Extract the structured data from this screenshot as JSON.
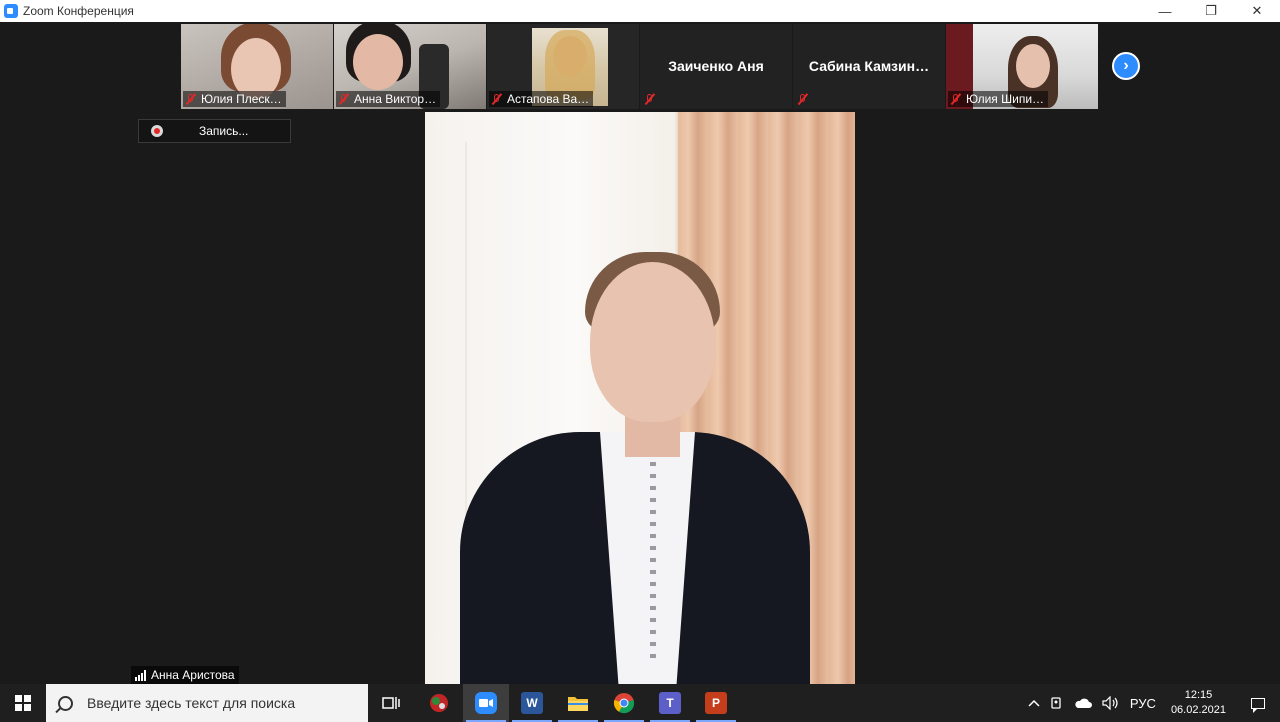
{
  "window": {
    "title": "Zoom Конференция",
    "minimize": "—",
    "restore": "❐",
    "close": "✕"
  },
  "participants": [
    {
      "name": "Юлия Плеск…",
      "video": true,
      "muted": true
    },
    {
      "name": "Анна Виктор…",
      "video": true,
      "muted": true
    },
    {
      "name": "Астапова Ва…",
      "video": true,
      "muted": true
    },
    {
      "name": "Заиченко Аня",
      "video": false,
      "muted": true
    },
    {
      "name": "Сабина  Камзин…",
      "video": false,
      "muted": true
    },
    {
      "name": "Юлия Шипи…",
      "video": true,
      "muted": true
    }
  ],
  "next_page_glyph": "›",
  "recording": {
    "label": "Запись..."
  },
  "active_speaker": {
    "name": "Анна Аристова"
  },
  "taskbar": {
    "search_placeholder": "Введите здесь текст для поиска",
    "tray": {
      "language": "РУС",
      "time": "12:15",
      "date": "06.02.2021"
    }
  },
  "colors": {
    "zoom_blue": "#2d8cff",
    "muted_red": "#e02828",
    "background": "#1a1a1a"
  }
}
